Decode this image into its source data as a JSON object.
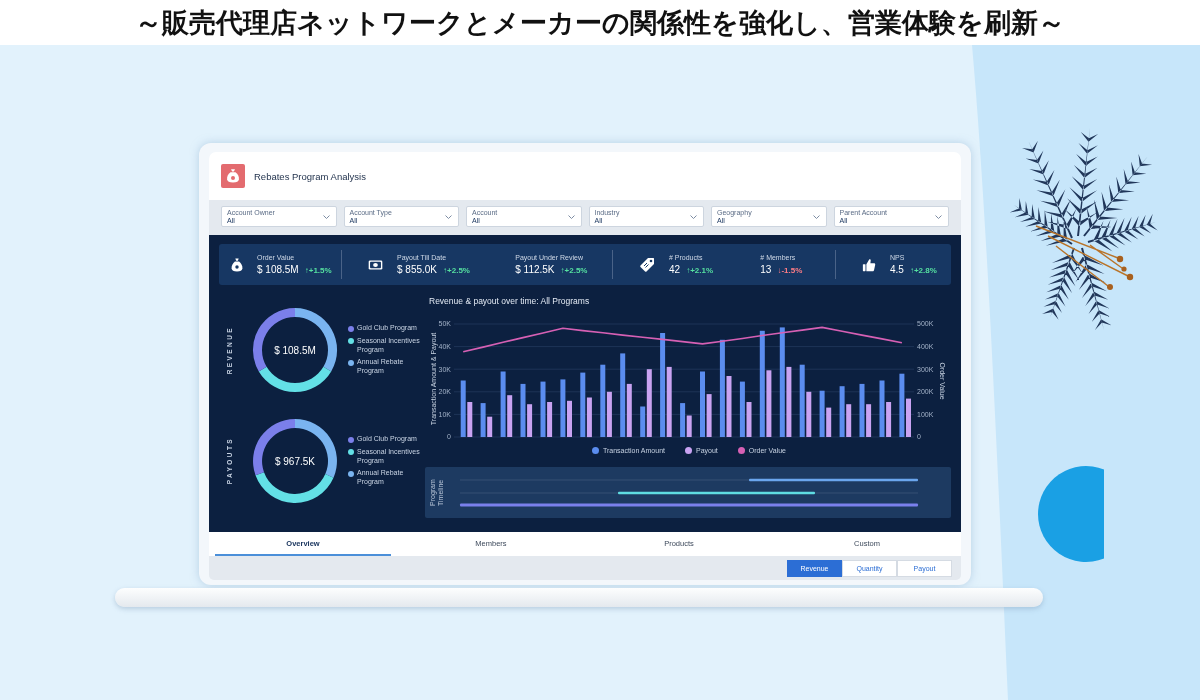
{
  "headline": "～販売代理店ネットワークとメーカーの関係性を強化し、営業体験を刷新～",
  "dashboard": {
    "title": "Rebates Program Analysis",
    "filters": [
      {
        "label": "Account Owner",
        "value": "All"
      },
      {
        "label": "Account Type",
        "value": "All"
      },
      {
        "label": "Account",
        "value": "All"
      },
      {
        "label": "Industry",
        "value": "All"
      },
      {
        "label": "Geography",
        "value": "All"
      },
      {
        "label": "Parent Account",
        "value": "All"
      }
    ],
    "kpi_groups": [
      {
        "metrics": [
          {
            "label": "Order Value",
            "value": "$ 108.5M",
            "change": "↑+1.5%",
            "color": "#55e0a0"
          }
        ]
      },
      {
        "metrics": [
          {
            "label": "Payout Till Date",
            "value": "$ 855.0K",
            "change": "↑+2.5%",
            "color": "#55e0a0"
          },
          {
            "label": "Payout Under Review",
            "value": "$ 112.5K",
            "change": "↑+2.5%",
            "color": "#55e0a0"
          }
        ]
      },
      {
        "metrics": [
          {
            "label": "# Products",
            "value": "42",
            "change": "↑+2.1%",
            "color": "#55e0a0"
          },
          {
            "label": "# Members",
            "value": "13",
            "change": "↓-1.5%",
            "color": "#ff7d86"
          }
        ]
      },
      {
        "metrics": [
          {
            "label": "NPS",
            "value": "4.5",
            "change": "↑+2.8%",
            "color": "#55e0a0"
          }
        ]
      }
    ],
    "donuts": [
      {
        "title": "REVENUE",
        "total": "$ 108.5M",
        "legend": [
          {
            "label": "Gold Club Program",
            "color": "#7b7fea"
          },
          {
            "label": "Seasonal Incentives Program",
            "color": "#63e0e6"
          },
          {
            "label": "Annual Rebate Program",
            "color": "#7ab4f0"
          }
        ]
      },
      {
        "title": "PAYOUTS",
        "total": "$ 967.5K",
        "legend": [
          {
            "label": "Gold Club Program",
            "color": "#7b7fea"
          },
          {
            "label": "Seasonal Incentives Program",
            "color": "#63e0e6"
          },
          {
            "label": "Annual Rebate Program",
            "color": "#7ab4f0"
          }
        ]
      }
    ],
    "chart": {
      "chart_data": {
        "type": "bar",
        "title": "Revenue & payout over time: All Programs",
        "ylabel": "Transaction Amount & Payout",
        "y2label": "Order Value",
        "grid": true,
        "legend": "bottom",
        "ylim": [
          0,
          50000
        ],
        "y2lim": [
          0,
          500000
        ],
        "yticks": [
          {
            "value": 0,
            "label": "0"
          },
          {
            "value": 10000,
            "label": "10K"
          },
          {
            "value": 20000,
            "label": "20K"
          },
          {
            "value": 30000,
            "label": "30K"
          },
          {
            "value": 40000,
            "label": "40K"
          },
          {
            "value": 50000,
            "label": "50K"
          }
        ],
        "y2ticks": [
          {
            "value": 0,
            "label": "0"
          },
          {
            "value": 100000,
            "label": "100K"
          },
          {
            "value": 200000,
            "label": "200K"
          },
          {
            "value": 300000,
            "label": "300K"
          },
          {
            "value": 400000,
            "label": "400K"
          },
          {
            "value": 500000,
            "label": "500K"
          }
        ],
        "series": [
          {
            "name": "Transaction Amount",
            "color": "#5b8def",
            "values": [
              25000,
              15000,
              29000,
              23500,
              24500,
              25500,
              28500,
              32000,
              37000,
              13500,
              46000,
              15000,
              29000,
              43000,
              24500,
              47000,
              48500,
              32000,
              20500,
              22500,
              23500,
              25000,
              28000
            ]
          },
          {
            "name": "Payout",
            "color": "#c9a3f2",
            "values": [
              15500,
              9000,
              18500,
              14500,
              15500,
              16000,
              17500,
              20000,
              23500,
              30000,
              31000,
              9500,
              19000,
              27000,
              15500,
              29500,
              31000,
              20000,
              13000,
              14500,
              14500,
              15500,
              17000
            ]
          },
          {
            "name": "Order Value",
            "type": "line",
            "axis": "y2",
            "color": "#d660b4",
            "values": [
              377000,
              398000,
              419000,
              440000,
              460000,
              481000,
              471000,
              461000,
              451000,
              441000,
              432000,
              422000,
              412000,
              424000,
              436000,
              449000,
              461000,
              473000,
              485000,
              468000,
              451000,
              434000,
              417000
            ]
          }
        ]
      }
    },
    "timeline": {
      "label": "Program Timeline"
    },
    "tabs": [
      {
        "label": "Overview",
        "selected": true
      },
      {
        "label": "Members",
        "selected": false
      },
      {
        "label": "Products",
        "selected": false
      },
      {
        "label": "Custom",
        "selected": false
      }
    ],
    "view_buttons": [
      {
        "label": "Revenue",
        "selected": true
      },
      {
        "label": "Quantity",
        "selected": false
      },
      {
        "label": "Payout",
        "selected": false
      }
    ]
  }
}
